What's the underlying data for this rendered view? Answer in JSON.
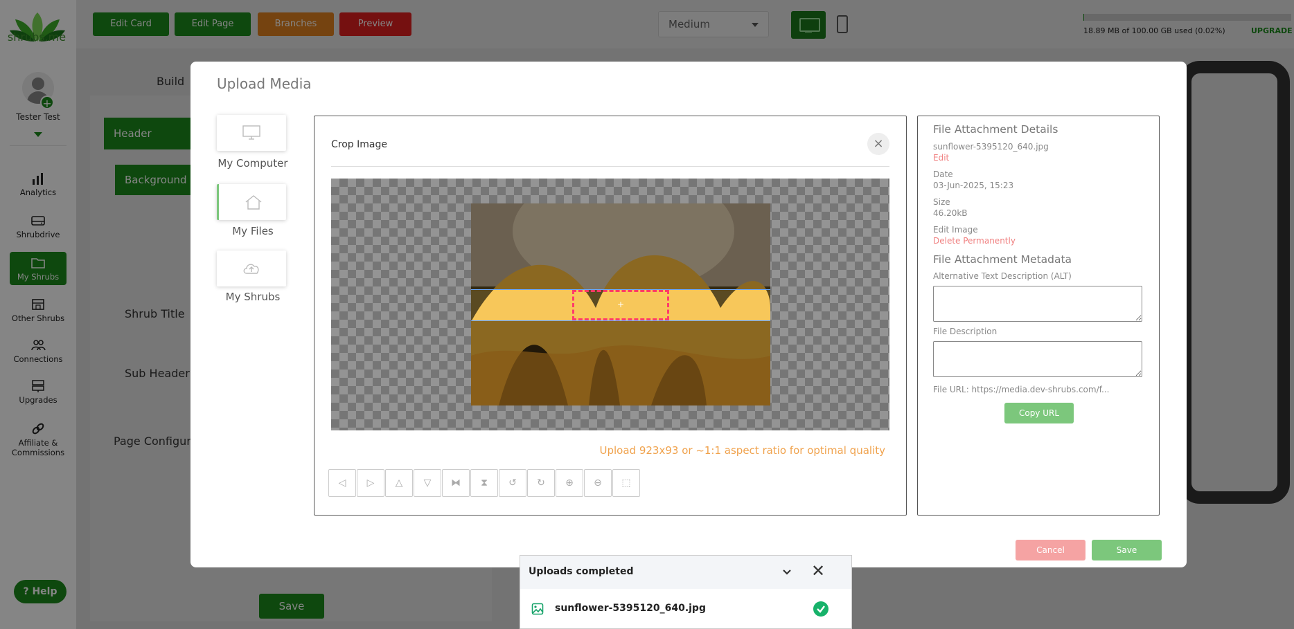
{
  "sidebar": {
    "brand": "shrubs.me",
    "user_name": "Tester Test",
    "items": [
      {
        "label": "Analytics",
        "icon": "bar-chart-icon"
      },
      {
        "label": "Shrubdrive",
        "icon": "drive-icon"
      },
      {
        "label": "My Shrubs",
        "icon": "folder-icon",
        "active": true
      },
      {
        "label": "Other Shrubs",
        "icon": "store-icon"
      },
      {
        "label": "Connections",
        "icon": "people-icon"
      },
      {
        "label": "Upgrades",
        "icon": "server-icon"
      },
      {
        "label": "Affiliate & Commissions",
        "icon": "link-icon"
      }
    ],
    "help_label": "Help"
  },
  "topbar": {
    "buttons": [
      {
        "label": "Edit Card",
        "color": "#1b8a1b"
      },
      {
        "label": "Edit Page",
        "color": "#1b8a1b"
      },
      {
        "label": "Branches",
        "color": "#e0801f"
      },
      {
        "label": "Preview",
        "color": "#e02020"
      }
    ],
    "view_select": "Medium",
    "storage_text": "18.89 MB of 100.00 GB used (0.02%)",
    "storage_fraction": 0.0002,
    "upgrade_label": "UPGRADE"
  },
  "editor": {
    "tab_build": "Build",
    "section_header": "Header",
    "section_background": "Background",
    "field_shrub_title": "Shrub Title",
    "field_sub_header": "Sub Header",
    "page_configuration": "Page Configura",
    "save_label": "Save"
  },
  "modal": {
    "title": "Upload Media",
    "sources": [
      {
        "label": "My Computer",
        "icon": "monitor-icon"
      },
      {
        "label": "My Files",
        "icon": "home-icon",
        "active": true
      },
      {
        "label": "My Shrubs",
        "icon": "cloud-upload-icon"
      }
    ],
    "crop": {
      "title": "Crop Image",
      "close": "×",
      "hint": "Upload 923x93 or ~1:1 aspect ratio for optimal quality",
      "tools": [
        {
          "name": "move-left-icon",
          "glyph": "◁"
        },
        {
          "name": "move-right-icon",
          "glyph": "▷"
        },
        {
          "name": "move-up-icon",
          "glyph": "△"
        },
        {
          "name": "move-down-icon",
          "glyph": "▽"
        },
        {
          "name": "flip-horizontal-icon",
          "glyph": "⧓"
        },
        {
          "name": "flip-vertical-icon",
          "glyph": "⧗"
        },
        {
          "name": "rotate-left-icon",
          "glyph": "↺"
        },
        {
          "name": "rotate-right-icon",
          "glyph": "↻"
        },
        {
          "name": "zoom-in-icon",
          "glyph": "⊕"
        },
        {
          "name": "zoom-out-icon",
          "glyph": "⊖"
        },
        {
          "name": "reset-crop-icon",
          "glyph": "⬚"
        }
      ]
    },
    "details": {
      "heading": "File Attachment Details",
      "file_name": "sunflower-5395120_640.jpg",
      "edit_link": "Edit",
      "date_label": "Date",
      "date_value": "03-Jun-2025, 15:23",
      "size_label": "Size",
      "size_value": "46.20kB",
      "edit_image_label": "Edit Image",
      "delete_link": "Delete Permanently",
      "metadata_heading": "File Attachment Metadata",
      "alt_label": "Alternative Text Description (ALT)",
      "alt_value": "",
      "desc_label": "File Description",
      "desc_value": "",
      "url_text": "File URL: https://media.dev-shrubs.com/f...",
      "copy_url": "Copy URL"
    },
    "cancel_label": "Cancel",
    "save_label": "Save"
  },
  "uploads": {
    "title": "Uploads completed",
    "file_name": "sunflower-5395120_640.jpg",
    "status": "completed"
  },
  "colors": {
    "brand_green": "#1b8a1b",
    "warning_orange": "#f0a24c",
    "danger_pink": "#f08080",
    "crop_box": "#ff3b6b"
  }
}
